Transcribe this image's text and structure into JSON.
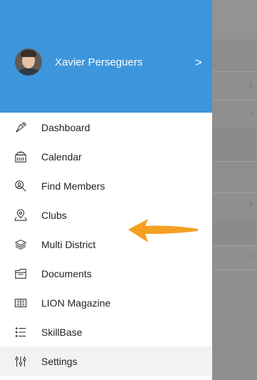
{
  "drawer": {
    "user": {
      "name": "Xavier Perseguers"
    }
  },
  "menu": {
    "items": [
      {
        "label": "Dashboard",
        "icon": "dashboard-icon"
      },
      {
        "label": "Calendar",
        "icon": "calendar-icon"
      },
      {
        "label": "Find Members",
        "icon": "search-people-icon"
      },
      {
        "label": "Clubs",
        "icon": "location-pin-icon"
      },
      {
        "label": "Multi District",
        "icon": "layers-icon"
      },
      {
        "label": "Documents",
        "icon": "folder-icon"
      },
      {
        "label": "LION Magazine",
        "icon": "magazine-icon"
      },
      {
        "label": "SkillBase",
        "icon": "list-icon"
      },
      {
        "label": "Settings",
        "icon": "sliders-icon"
      }
    ]
  },
  "colors": {
    "header": "#3d96dc",
    "annotation_arrow": "#f5a023",
    "backdrop": "#8f8f8f"
  }
}
